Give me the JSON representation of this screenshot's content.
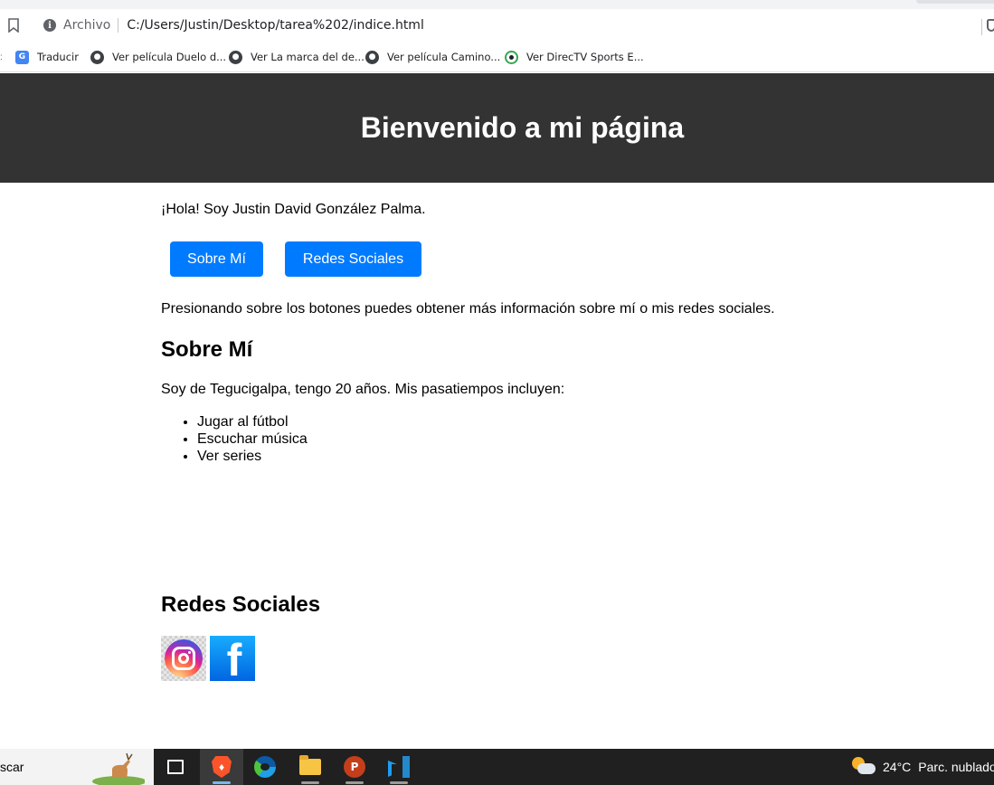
{
  "browser": {
    "scheme_label": "Archivo",
    "url": "C:/Users/Justin/Desktop/tarea%202/indice.html",
    "bookmarks": [
      {
        "label": "Traducir",
        "icon": "google-translate-icon"
      },
      {
        "label": "Ver película Duelo d...",
        "icon": "globe-icon"
      },
      {
        "label": "Ver La marca del de...",
        "icon": "globe-icon"
      },
      {
        "label": "Ver película Camino...",
        "icon": "globe-icon"
      },
      {
        "label": "Ver DirecTV Sports E...",
        "icon": "soccer-ball-icon"
      }
    ]
  },
  "page": {
    "header_title": "Bienvenido a mi página",
    "intro": "¡Hola! Soy Justin David González Palma.",
    "buttons": {
      "about": "Sobre Mí",
      "social": "Redes Sociales"
    },
    "hint": "Presionando sobre los botones puedes obtener más información sobre mí o mis redes sociales.",
    "about_section": {
      "heading": "Sobre Mí",
      "text": "Soy de Tegucigalpa, tengo 20 años. Mis pasatiempos incluyen:",
      "hobbies": [
        "Jugar al fútbol",
        "Escuchar música",
        "Ver series"
      ]
    },
    "social_section": {
      "heading": "Redes Sociales",
      "links": [
        {
          "icon": "instagram-icon"
        },
        {
          "icon": "facebook-icon"
        }
      ]
    },
    "colors": {
      "header_bg": "#333333",
      "button_bg": "#007bff"
    }
  },
  "taskbar": {
    "search_text": "scar",
    "apps": [
      "task-view-icon",
      "brave-icon",
      "edge-icon",
      "file-explorer-icon",
      "powerpoint-icon",
      "vscode-icon"
    ],
    "weather": {
      "temperature": "24°C",
      "condition": "Parc. nublado"
    }
  }
}
